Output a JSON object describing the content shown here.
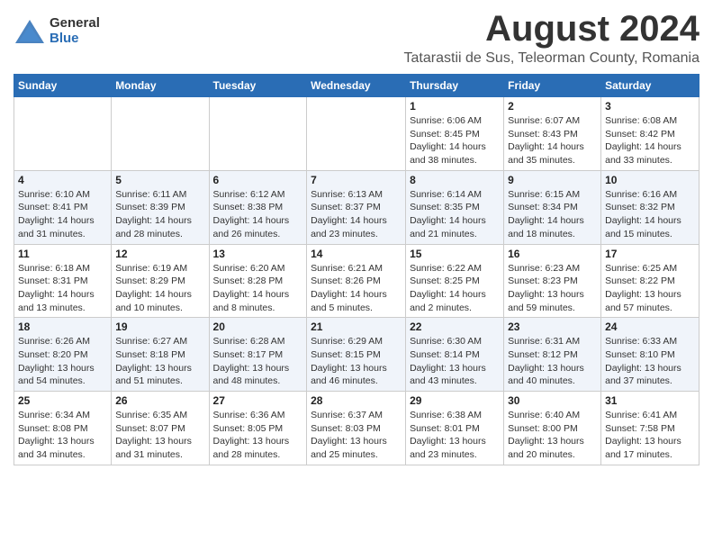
{
  "header": {
    "logo_general": "General",
    "logo_blue": "Blue",
    "month_year": "August 2024",
    "location": "Tatarastii de Sus, Teleorman County, Romania"
  },
  "days_of_week": [
    "Sunday",
    "Monday",
    "Tuesday",
    "Wednesday",
    "Thursday",
    "Friday",
    "Saturday"
  ],
  "weeks": [
    {
      "days": [
        {
          "num": "",
          "detail": ""
        },
        {
          "num": "",
          "detail": ""
        },
        {
          "num": "",
          "detail": ""
        },
        {
          "num": "",
          "detail": ""
        },
        {
          "num": "1",
          "detail": "Sunrise: 6:06 AM\nSunset: 8:45 PM\nDaylight: 14 hours\nand 38 minutes."
        },
        {
          "num": "2",
          "detail": "Sunrise: 6:07 AM\nSunset: 8:43 PM\nDaylight: 14 hours\nand 35 minutes."
        },
        {
          "num": "3",
          "detail": "Sunrise: 6:08 AM\nSunset: 8:42 PM\nDaylight: 14 hours\nand 33 minutes."
        }
      ]
    },
    {
      "days": [
        {
          "num": "4",
          "detail": "Sunrise: 6:10 AM\nSunset: 8:41 PM\nDaylight: 14 hours\nand 31 minutes."
        },
        {
          "num": "5",
          "detail": "Sunrise: 6:11 AM\nSunset: 8:39 PM\nDaylight: 14 hours\nand 28 minutes."
        },
        {
          "num": "6",
          "detail": "Sunrise: 6:12 AM\nSunset: 8:38 PM\nDaylight: 14 hours\nand 26 minutes."
        },
        {
          "num": "7",
          "detail": "Sunrise: 6:13 AM\nSunset: 8:37 PM\nDaylight: 14 hours\nand 23 minutes."
        },
        {
          "num": "8",
          "detail": "Sunrise: 6:14 AM\nSunset: 8:35 PM\nDaylight: 14 hours\nand 21 minutes."
        },
        {
          "num": "9",
          "detail": "Sunrise: 6:15 AM\nSunset: 8:34 PM\nDaylight: 14 hours\nand 18 minutes."
        },
        {
          "num": "10",
          "detail": "Sunrise: 6:16 AM\nSunset: 8:32 PM\nDaylight: 14 hours\nand 15 minutes."
        }
      ]
    },
    {
      "days": [
        {
          "num": "11",
          "detail": "Sunrise: 6:18 AM\nSunset: 8:31 PM\nDaylight: 14 hours\nand 13 minutes."
        },
        {
          "num": "12",
          "detail": "Sunrise: 6:19 AM\nSunset: 8:29 PM\nDaylight: 14 hours\nand 10 minutes."
        },
        {
          "num": "13",
          "detail": "Sunrise: 6:20 AM\nSunset: 8:28 PM\nDaylight: 14 hours\nand 8 minutes."
        },
        {
          "num": "14",
          "detail": "Sunrise: 6:21 AM\nSunset: 8:26 PM\nDaylight: 14 hours\nand 5 minutes."
        },
        {
          "num": "15",
          "detail": "Sunrise: 6:22 AM\nSunset: 8:25 PM\nDaylight: 14 hours\nand 2 minutes."
        },
        {
          "num": "16",
          "detail": "Sunrise: 6:23 AM\nSunset: 8:23 PM\nDaylight: 13 hours\nand 59 minutes."
        },
        {
          "num": "17",
          "detail": "Sunrise: 6:25 AM\nSunset: 8:22 PM\nDaylight: 13 hours\nand 57 minutes."
        }
      ]
    },
    {
      "days": [
        {
          "num": "18",
          "detail": "Sunrise: 6:26 AM\nSunset: 8:20 PM\nDaylight: 13 hours\nand 54 minutes."
        },
        {
          "num": "19",
          "detail": "Sunrise: 6:27 AM\nSunset: 8:18 PM\nDaylight: 13 hours\nand 51 minutes."
        },
        {
          "num": "20",
          "detail": "Sunrise: 6:28 AM\nSunset: 8:17 PM\nDaylight: 13 hours\nand 48 minutes."
        },
        {
          "num": "21",
          "detail": "Sunrise: 6:29 AM\nSunset: 8:15 PM\nDaylight: 13 hours\nand 46 minutes."
        },
        {
          "num": "22",
          "detail": "Sunrise: 6:30 AM\nSunset: 8:14 PM\nDaylight: 13 hours\nand 43 minutes."
        },
        {
          "num": "23",
          "detail": "Sunrise: 6:31 AM\nSunset: 8:12 PM\nDaylight: 13 hours\nand 40 minutes."
        },
        {
          "num": "24",
          "detail": "Sunrise: 6:33 AM\nSunset: 8:10 PM\nDaylight: 13 hours\nand 37 minutes."
        }
      ]
    },
    {
      "days": [
        {
          "num": "25",
          "detail": "Sunrise: 6:34 AM\nSunset: 8:08 PM\nDaylight: 13 hours\nand 34 minutes."
        },
        {
          "num": "26",
          "detail": "Sunrise: 6:35 AM\nSunset: 8:07 PM\nDaylight: 13 hours\nand 31 minutes."
        },
        {
          "num": "27",
          "detail": "Sunrise: 6:36 AM\nSunset: 8:05 PM\nDaylight: 13 hours\nand 28 minutes."
        },
        {
          "num": "28",
          "detail": "Sunrise: 6:37 AM\nSunset: 8:03 PM\nDaylight: 13 hours\nand 25 minutes."
        },
        {
          "num": "29",
          "detail": "Sunrise: 6:38 AM\nSunset: 8:01 PM\nDaylight: 13 hours\nand 23 minutes."
        },
        {
          "num": "30",
          "detail": "Sunrise: 6:40 AM\nSunset: 8:00 PM\nDaylight: 13 hours\nand 20 minutes."
        },
        {
          "num": "31",
          "detail": "Sunrise: 6:41 AM\nSunset: 7:58 PM\nDaylight: 13 hours\nand 17 minutes."
        }
      ]
    }
  ]
}
